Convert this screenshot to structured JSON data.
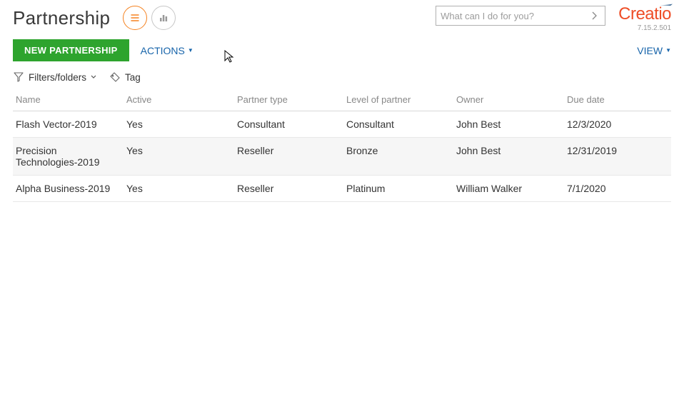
{
  "header": {
    "title": "Partnership",
    "search_placeholder": "What can I do for you?"
  },
  "brand": {
    "name": "Creatio",
    "version": "7.15.2.501"
  },
  "toolbar": {
    "new_button": "NEW PARTNERSHIP",
    "actions": "ACTIONS",
    "view": "VIEW"
  },
  "filters": {
    "folders_label": "Filters/folders",
    "tag_label": "Tag"
  },
  "table": {
    "columns": {
      "name": "Name",
      "active": "Active",
      "partner_type": "Partner type",
      "level": "Level of partner",
      "owner": "Owner",
      "due_date": "Due date"
    },
    "rows": [
      {
        "name": "Flash Vector-2019",
        "active": "Yes",
        "partner_type": "Consultant",
        "level": "Consultant",
        "owner": "John Best",
        "due_date": "12/3/2020"
      },
      {
        "name": "Precision Technologies-2019",
        "active": "Yes",
        "partner_type": "Reseller",
        "level": "Bronze",
        "owner": "John Best",
        "due_date": "12/31/2019"
      },
      {
        "name": "Alpha Business-2019",
        "active": "Yes",
        "partner_type": "Reseller",
        "level": "Platinum",
        "owner": "William Walker",
        "due_date": "7/1/2020"
      }
    ]
  }
}
